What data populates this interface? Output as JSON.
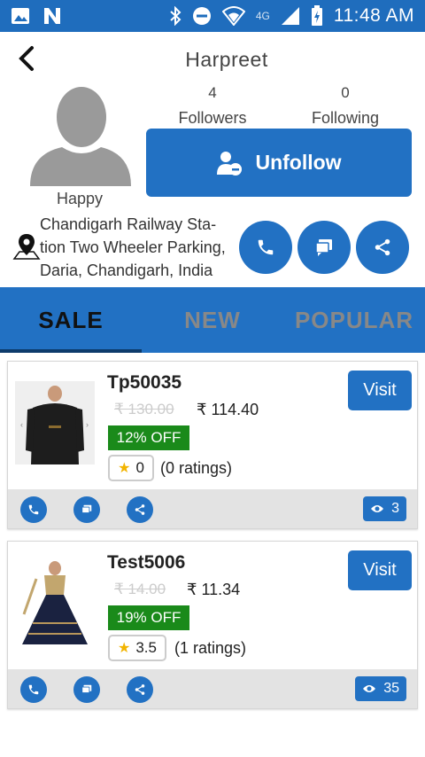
{
  "status_bar": {
    "time": "11:48 AM",
    "network": "4G"
  },
  "header": {
    "title": "Harpreet"
  },
  "profile": {
    "status": "Happy",
    "followers_count": "4",
    "followers_label": "Followers",
    "following_count": "0",
    "following_label": "Following",
    "unfollow_label": "Unfollow",
    "address_lines": [
      "Chandigarh Railway Sta-",
      "tion Two Wheeler Parking,",
      "Daria, Chandigarh, India"
    ]
  },
  "tabs": [
    {
      "label": "SALE"
    },
    {
      "label": "NEW"
    },
    {
      "label": "POPULAR"
    }
  ],
  "products": [
    {
      "name": "Tp50035",
      "mrp": "₹ 130.00",
      "price": "₹ 114.40",
      "discount": "12% OFF",
      "rating": "0",
      "ratings_text": "(0 ratings)",
      "visit_label": "Visit",
      "views": "3"
    },
    {
      "name": "Test5006",
      "mrp": "₹ 14.00",
      "price": "₹ 11.34",
      "discount": "19% OFF",
      "rating": "3.5",
      "ratings_text": "(1 ratings)",
      "visit_label": "Visit",
      "views": "35"
    }
  ],
  "colors": {
    "primary": "#2271c3",
    "discount": "#1a8a1a",
    "status_bar": "#1f6dbd"
  }
}
